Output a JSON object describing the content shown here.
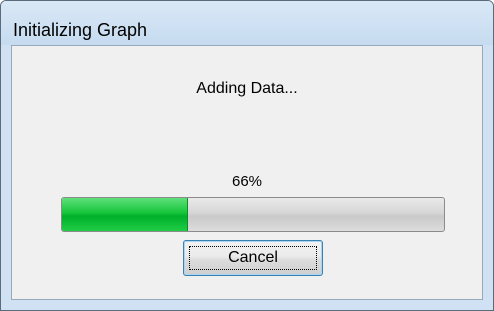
{
  "window": {
    "title": "Initializing Graph"
  },
  "dialog": {
    "message": "Adding Data...",
    "progress_text": "66%",
    "progress_fraction": 0.33,
    "progress_color": "#16c53b",
    "cancel_label": "Cancel"
  }
}
